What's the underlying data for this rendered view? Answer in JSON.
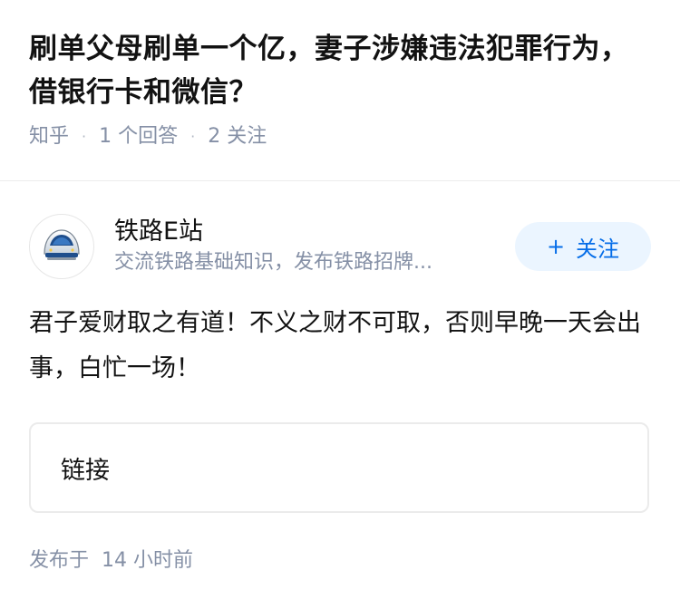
{
  "question": {
    "title": "刷单父母刷单一个亿，妻子涉嫌违法犯罪行为，借银行卡和微信？",
    "source": "知乎",
    "answer_count": "1 个回答",
    "follow_count": "2 关注"
  },
  "answer": {
    "author": {
      "name": "铁路E站",
      "bio": "交流铁路基础知识，发布铁路招牌...",
      "avatar_icon": "bullet-train-icon"
    },
    "follow_button": {
      "plus": "+",
      "label": "关注"
    },
    "content": "君子爱财取之有道！不义之财不可取，否则早晚一天会出事，白忙一场！",
    "link_card": {
      "label": "链接"
    },
    "publish_label": "发布于",
    "publish_time": "14 小时前"
  },
  "colors": {
    "accent": "#056de8",
    "accent_bg": "#ebf5ff",
    "meta_text": "#8590a6",
    "primary_text": "#121212"
  }
}
